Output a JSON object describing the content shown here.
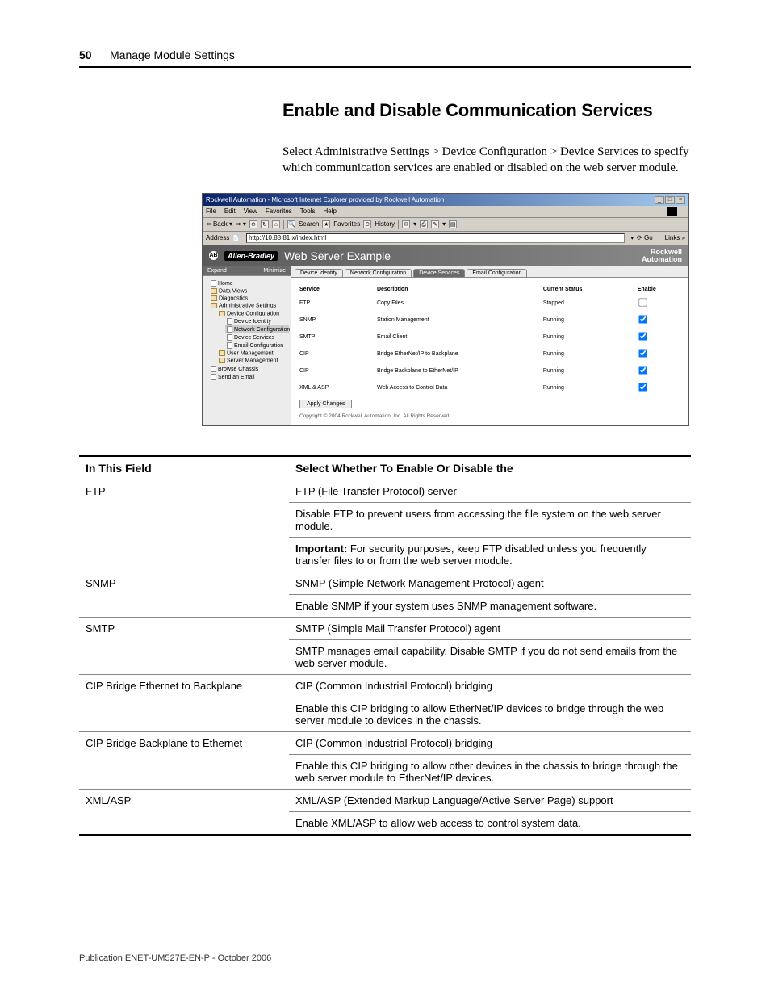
{
  "header": {
    "page_number": "50",
    "chapter": "Manage Module Settings"
  },
  "section": {
    "heading": "Enable and Disable Communication Services",
    "paragraph": "Select Administrative Settings > Device Configuration > Device Services to specify which communication services are enabled or disabled on the web server module."
  },
  "screenshot": {
    "window_title": "Rockwell Automation - Microsoft Internet Explorer provided by Rockwell Automation",
    "menu": [
      "File",
      "Edit",
      "View",
      "Favorites",
      "Tools",
      "Help"
    ],
    "toolbar": {
      "back": "Back",
      "search": "Search",
      "favorites": "Favorites",
      "history": "History"
    },
    "address_label": "Address",
    "address_url": "http://10.88.81.x/index.html",
    "go": "Go",
    "links": "Links",
    "banner": {
      "brand": "Allen-Bradley",
      "title": "Web Server Example",
      "logo_line1": "Rockwell",
      "logo_line2": "Automation"
    },
    "sidebar": {
      "expand": "Expand",
      "minimize": "Minimize",
      "items": [
        {
          "label": "Home",
          "level": 1,
          "type": "doc"
        },
        {
          "label": "Data Views",
          "level": 1,
          "type": "folder"
        },
        {
          "label": "Diagnostics",
          "level": 1,
          "type": "folder"
        },
        {
          "label": "Administrative Settings",
          "level": 1,
          "type": "folder"
        },
        {
          "label": "Device Configuration",
          "level": 2,
          "type": "folder"
        },
        {
          "label": "Device Identity",
          "level": 3,
          "type": "doc"
        },
        {
          "label": "Network Configuration",
          "level": 3,
          "type": "doc",
          "sel": true
        },
        {
          "label": "Device Services",
          "level": 3,
          "type": "doc"
        },
        {
          "label": "Email Configuration",
          "level": 3,
          "type": "doc"
        },
        {
          "label": "User Management",
          "level": 2,
          "type": "folder"
        },
        {
          "label": "Server Management",
          "level": 2,
          "type": "folder"
        },
        {
          "label": "Browse Chassis",
          "level": 1,
          "type": "doc"
        },
        {
          "label": "Send an Email",
          "level": 1,
          "type": "doc"
        }
      ]
    },
    "tabs": [
      "Device Identity",
      "Network Configuration",
      "Device Services",
      "Email Configuration"
    ],
    "table": {
      "headers": [
        "Service",
        "Description",
        "Current Status",
        "Enable"
      ],
      "rows": [
        {
          "service": "FTP",
          "desc": "Copy Files",
          "status": "Stopped",
          "enabled": false
        },
        {
          "service": "SNMP",
          "desc": "Station Management",
          "status": "Running",
          "enabled": true
        },
        {
          "service": "SMTP",
          "desc": "Email Client",
          "status": "Running",
          "enabled": true
        },
        {
          "service": "CIP",
          "desc": "Bridge EtherNet/IP to Backplane",
          "status": "Running",
          "enabled": true
        },
        {
          "service": "CIP",
          "desc": "Bridge Backplane to EtherNet/IP",
          "status": "Running",
          "enabled": true
        },
        {
          "service": "XML & ASP",
          "desc": "Web Access to Control Data",
          "status": "Running",
          "enabled": true
        }
      ],
      "apply": "Apply Changes"
    },
    "copyright": "Copyright © 2004 Rockwell Automation, Inc. All Rights Reserved."
  },
  "table": {
    "header_field": "In This Field",
    "header_desc": "Select Whether To Enable Or Disable the",
    "rows": [
      {
        "field": "FTP",
        "lines": [
          "FTP (File Transfer Protocol) server",
          "Disable FTP to prevent users from accessing the file system on the web server module.",
          {
            "important": "Important:",
            "rest": " For security purposes, keep FTP disabled unless you frequently transfer files to or from the web server module."
          }
        ]
      },
      {
        "field": "SNMP",
        "lines": [
          "SNMP (Simple Network Management Protocol) agent",
          "Enable SNMP if your system uses SNMP management software."
        ]
      },
      {
        "field": "SMTP",
        "lines": [
          "SMTP (Simple Mail Transfer Protocol) agent",
          "SMTP manages email capability. Disable SMTP if you do not send emails from the web server module."
        ]
      },
      {
        "field": "CIP Bridge Ethernet to Backplane",
        "lines": [
          "CIP (Common Industrial Protocol) bridging",
          "Enable this CIP bridging to allow EtherNet/IP devices to bridge through the web server module to devices in the chassis."
        ]
      },
      {
        "field": "CIP Bridge Backplane to Ethernet",
        "lines": [
          "CIP (Common Industrial Protocol) bridging",
          "Enable this CIP bridging to allow other devices in the chassis to bridge through the web server module to EtherNet/IP devices."
        ]
      },
      {
        "field": "XML/ASP",
        "lines": [
          "XML/ASP (Extended Markup Language/Active Server Page) support",
          "Enable XML/ASP to allow web access to control system data."
        ]
      }
    ]
  },
  "footer": "Publication ENET-UM527E-EN-P - October 2006"
}
